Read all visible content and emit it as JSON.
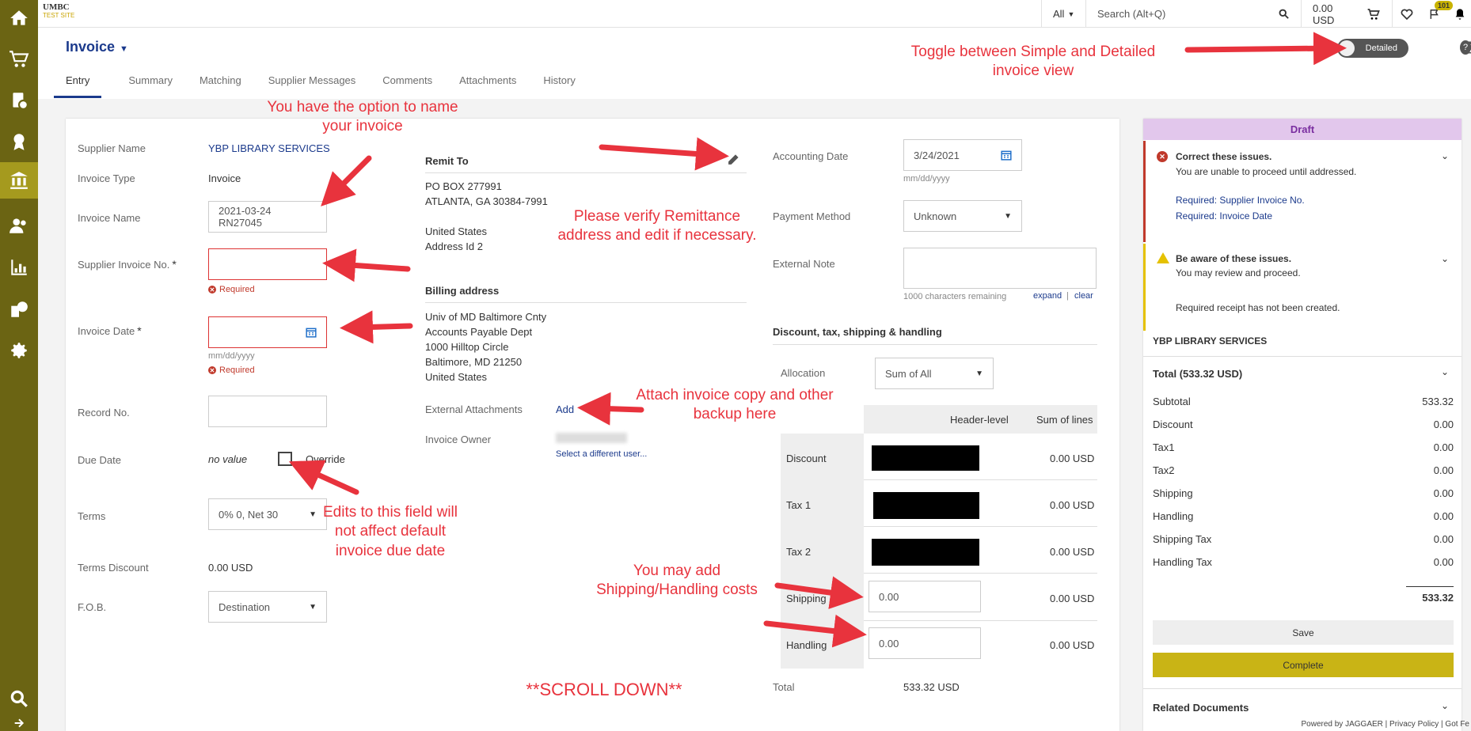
{
  "topbar": {
    "logo_line1": "UMBC",
    "logo_line2": "TEST SITE",
    "scope": "All",
    "search_placeholder": "Search (Alt+Q)",
    "cart_total": "0.00 USD",
    "notification_count": "101"
  },
  "header": {
    "title": "Invoice",
    "tabs": [
      "Entry",
      "Summary",
      "Matching",
      "Supplier Messages",
      "Comments",
      "Attachments",
      "History"
    ],
    "view_toggle": "Detailed"
  },
  "form": {
    "supplier_name_label": "Supplier Name",
    "supplier_name": "YBP LIBRARY SERVICES",
    "invoice_type_label": "Invoice Type",
    "invoice_type": "Invoice",
    "invoice_name_label": "Invoice Name",
    "invoice_name": "2021-03-24 RN27045",
    "supplier_invoice_no_label": "Supplier Invoice No.",
    "required": "Required",
    "invoice_date_label": "Invoice Date",
    "date_hint": "mm/dd/yyyy",
    "record_no_label": "Record No.",
    "due_date_label": "Due Date",
    "due_date_value": "no value",
    "override_label": "Override",
    "terms_label": "Terms",
    "terms_value": "0% 0, Net 30",
    "terms_discount_label": "Terms Discount",
    "terms_discount": "0.00 USD",
    "fob_label": "F.O.B.",
    "fob_value": "Destination"
  },
  "remit": {
    "heading": "Remit To",
    "line1": "PO BOX 277991",
    "line2": "ATLANTA, GA 30384-7991",
    "line3": "United States",
    "line4": "Address Id 2",
    "billing_heading": "Billing address",
    "b1": "Univ of MD Baltimore Cnty",
    "b2": "Accounts Payable Dept",
    "b3": "1000 Hilltop Circle",
    "b4": "Baltimore, MD 21250",
    "b5": "United States",
    "ext_attach_label": "External Attachments",
    "add": "Add",
    "owner_label": "Invoice Owner",
    "select_user": "Select a different user..."
  },
  "accounting": {
    "accounting_date_label": "Accounting Date",
    "accounting_date": "3/24/2021",
    "date_hint": "mm/dd/yyyy",
    "payment_method_label": "Payment Method",
    "payment_method": "Unknown",
    "external_note_label": "External Note",
    "chars_remaining": "1000 characters remaining",
    "expand": "expand",
    "clear": "clear",
    "dtsh_heading": "Discount, tax, shipping & handling",
    "allocation_label": "Allocation",
    "allocation": "Sum of All",
    "col_header": "Header-level",
    "col_lines": "Sum of lines",
    "rows": [
      {
        "label": "Discount",
        "lines": "0.00 USD"
      },
      {
        "label": "Tax 1",
        "lines": "0.00 USD"
      },
      {
        "label": "Tax 2",
        "lines": "0.00 USD"
      },
      {
        "label": "Shipping",
        "value": "0.00",
        "lines": "0.00 USD"
      },
      {
        "label": "Handling",
        "value": "0.00",
        "lines": "0.00 USD"
      }
    ],
    "total_label": "Total",
    "total": "533.32 USD"
  },
  "panel": {
    "status": "Draft",
    "correct_title": "Correct these issues.",
    "correct_sub": "You are unable to proceed until addressed.",
    "req1": "Required: Supplier Invoice No.",
    "req2": "Required: Invoice Date",
    "aware_title": "Be aware of these issues.",
    "aware_sub": "You may review and proceed.",
    "aware_msg": "Required receipt has not been created.",
    "supplier": "YBP LIBRARY SERVICES",
    "total_heading": "Total (533.32 USD)",
    "lines": [
      {
        "label": "Subtotal",
        "value": "533.32"
      },
      {
        "label": "Discount",
        "value": "0.00"
      },
      {
        "label": "Tax1",
        "value": "0.00"
      },
      {
        "label": "Tax2",
        "value": "0.00"
      },
      {
        "label": "Shipping",
        "value": "0.00"
      },
      {
        "label": "Handling",
        "value": "0.00"
      },
      {
        "label": "Shipping Tax",
        "value": "0.00"
      },
      {
        "label": "Handling Tax",
        "value": "0.00"
      }
    ],
    "grand_total": "533.32",
    "save": "Save",
    "complete": "Complete",
    "related": "Related Documents"
  },
  "annotations": {
    "toggle": "Toggle between Simple and Detailed invoice view",
    "name": "You have the option to name your invoice",
    "remit": "Please verify Remittance address and edit if necessary.",
    "attach": "Attach invoice copy and other backup here",
    "due": "Edits to this field will not affect default invoice due date",
    "shipping": "You may add Shipping/Handling costs",
    "scroll": "**SCROLL DOWN**"
  },
  "footer": {
    "powered": "Powered by JAGGAER | Privacy Policy | Got Fe"
  }
}
